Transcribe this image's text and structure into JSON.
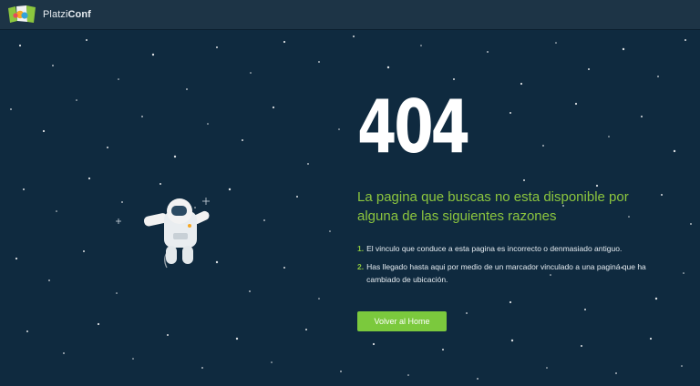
{
  "header": {
    "brand_light": "Platzi",
    "brand_bold": "Conf"
  },
  "error": {
    "code": "404",
    "message": "La pagina que buscas no esta disponible por alguna de las siguientes razones",
    "reasons": [
      {
        "number": "1.",
        "text": "El vinculo que conduce a esta pagina es incorrecto o denmasiado antiguo."
      },
      {
        "number": "2.",
        "text": "Has llegado hasta aqui por medio de un marcador vinculado a una paginá que ha cambiado de ubicación."
      }
    ],
    "home_button": "Volver al Home"
  },
  "colors": {
    "background": "#0f2a3f",
    "topbar": "#1d3446",
    "accent_green": "#8cc63e",
    "button_green": "#7bc93d"
  },
  "icons": [
    "platziconf-logo-icon",
    "astronaut-illustration",
    "sparkle-star-icon"
  ]
}
